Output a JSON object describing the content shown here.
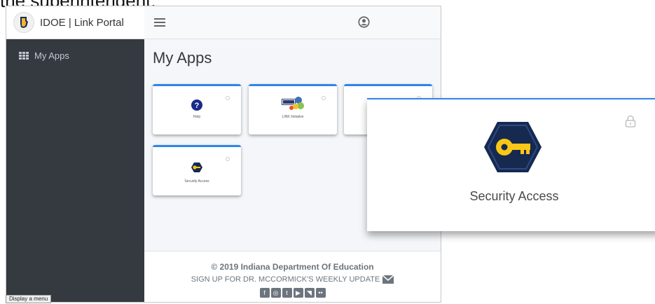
{
  "caption": "the superintendent.",
  "brand": {
    "title": "IDOE | Link Portal",
    "logo_icon": "indiana-state-icon"
  },
  "sidebar": {
    "items": [
      {
        "label": "My Apps",
        "icon": "grid-icon"
      }
    ]
  },
  "main": {
    "page_title": "My Apps",
    "tiles": [
      {
        "label": "Help",
        "icon": "question-circle-icon"
      },
      {
        "label": "LINK Initiative",
        "icon": "link-initiative-logo-icon"
      },
      {
        "label": "",
        "icon": "partial-tile-icon"
      },
      {
        "label": "Security Access",
        "icon": "key-hexagon-icon"
      }
    ]
  },
  "footer": {
    "copyright": "© 2019 Indiana Department Of Education",
    "signup": "SIGN UP FOR DR. MCCORMICK'S WEEKLY UPDATE",
    "social": [
      "facebook-icon",
      "instagram-icon",
      "twitter-icon",
      "youtube-icon",
      "rss-icon",
      "flickr-icon"
    ]
  },
  "tooltip": "Display a menu",
  "zoom": {
    "label": "Security Access",
    "icon": "key-hexagon-icon"
  },
  "colors": {
    "accent": "#2f86e6",
    "sidebar": "#343a40",
    "key_gold": "#f9c718",
    "hex_navy": "#16294f"
  }
}
